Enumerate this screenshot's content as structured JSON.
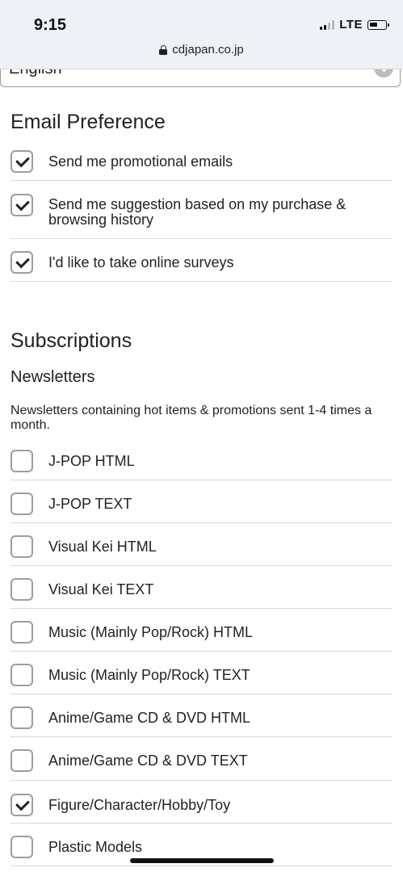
{
  "status_bar": {
    "time": "9:15",
    "network": "LTE",
    "signal_bars_filled": 2,
    "signal_bars_total": 4,
    "battery_level_percent": 40
  },
  "browser": {
    "url": "cdjapan.co.jp"
  },
  "language_select": {
    "value": "English"
  },
  "email_preference": {
    "title": "Email Preference",
    "options": [
      {
        "label": "Send me promotional emails",
        "checked": true
      },
      {
        "label": "Send me suggestion based on my purchase & browsing history",
        "checked": true
      },
      {
        "label": "I'd like to take online surveys",
        "checked": true
      }
    ]
  },
  "subscriptions": {
    "title": "Subscriptions",
    "newsletters_title": "Newsletters",
    "newsletters_description": "Newsletters containing hot items & promotions sent 1-4 times a month.",
    "items": [
      {
        "label": "J-POP HTML",
        "checked": false
      },
      {
        "label": "J-POP TEXT",
        "checked": false
      },
      {
        "label": "Visual Kei HTML",
        "checked": false
      },
      {
        "label": "Visual Kei TEXT",
        "checked": false
      },
      {
        "label": "Music (Mainly Pop/Rock) HTML",
        "checked": false
      },
      {
        "label": "Music (Mainly Pop/Rock) TEXT",
        "checked": false
      },
      {
        "label": "Anime/Game CD & DVD HTML",
        "checked": false
      },
      {
        "label": "Anime/Game CD & DVD TEXT",
        "checked": false
      },
      {
        "label": "Figure/Character/Hobby/Toy",
        "checked": true
      },
      {
        "label": "Plastic Models",
        "checked": false
      }
    ]
  }
}
